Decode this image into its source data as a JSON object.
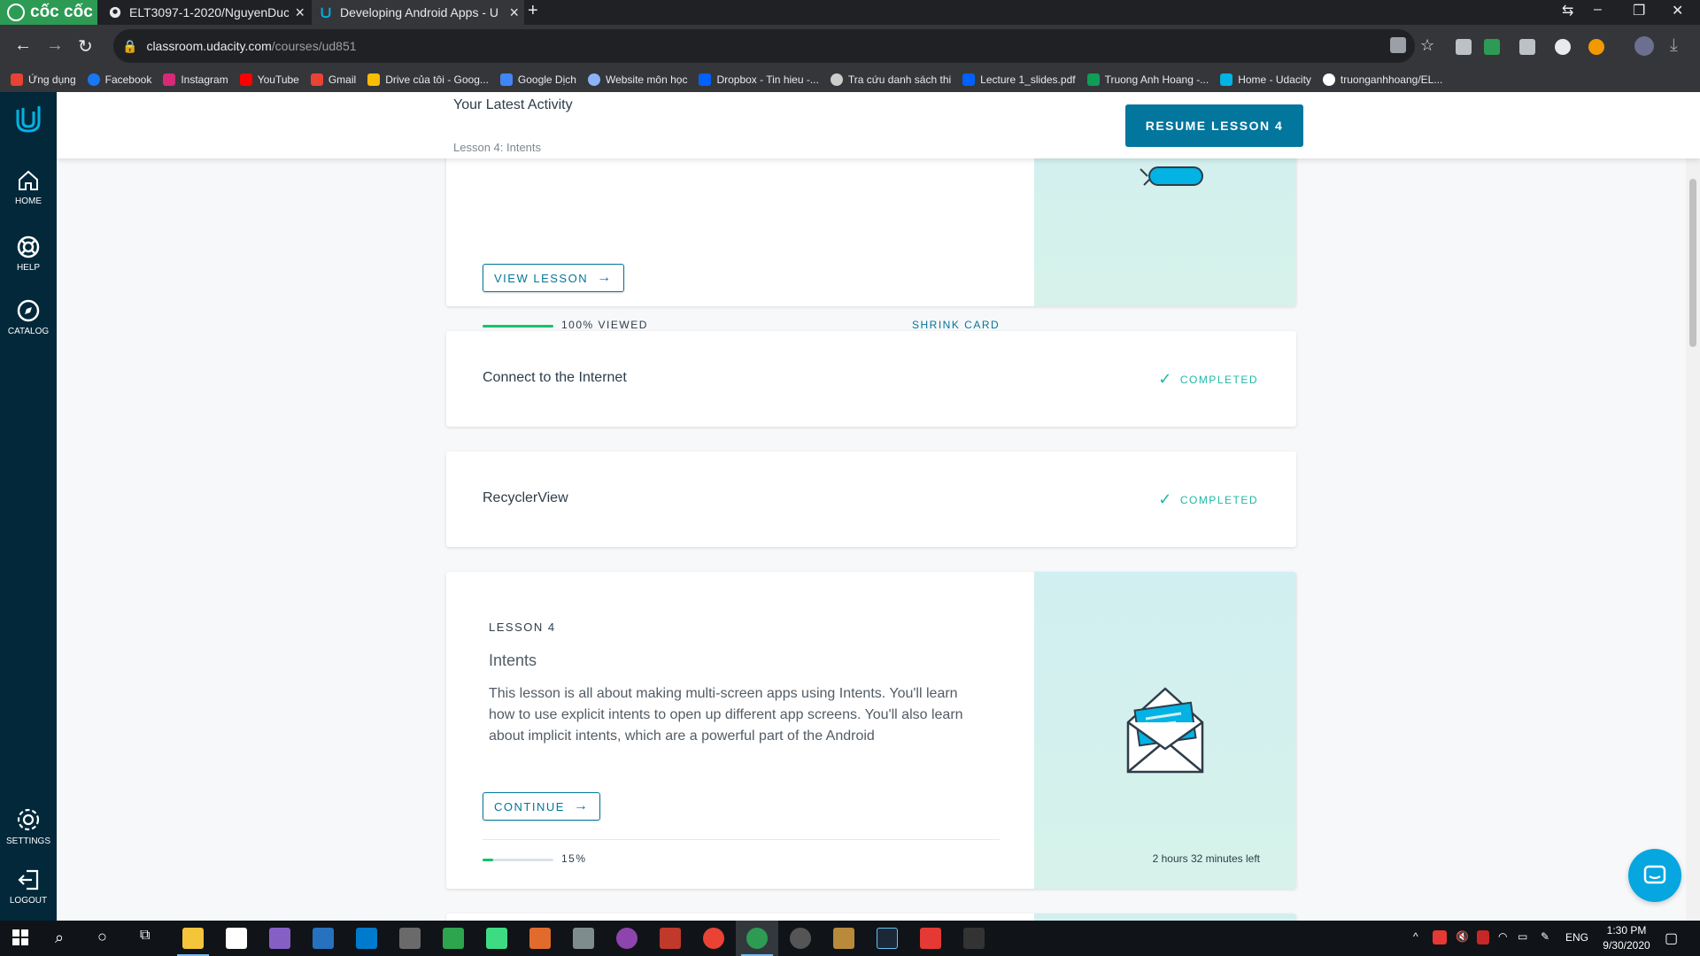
{
  "browser": {
    "brand_label": "cốc cốc",
    "tabs": [
      {
        "title": "ELT3097-1-2020/NguyenDuc",
        "icon": "github-icon"
      },
      {
        "title": "Developing Android Apps - U",
        "icon": "udacity-icon"
      }
    ],
    "url_host": "classroom.udacity.com",
    "url_path": "/courses/ud851",
    "bookmarks": [
      {
        "label": "Ứng dụng",
        "color": "#e94235"
      },
      {
        "label": "Facebook",
        "color": "#1877f2"
      },
      {
        "label": "Instagram",
        "color": "#d62976"
      },
      {
        "label": "YouTube",
        "color": "#ff0000"
      },
      {
        "label": "Gmail",
        "color": "#ea4335"
      },
      {
        "label": "Drive của tôi - Goog...",
        "color": "#fbbc04"
      },
      {
        "label": "Google Dịch",
        "color": "#4285f4"
      },
      {
        "label": "Website môn học",
        "color": "#8ab4f8"
      },
      {
        "label": "Dropbox - Tin hieu -...",
        "color": "#0061ff"
      },
      {
        "label": "Tra cứu danh sách thi",
        "color": "#cccccc"
      },
      {
        "label": "Lecture 1_slides.pdf",
        "color": "#0061ff"
      },
      {
        "label": "Truong Anh Hoang -...",
        "color": "#0f9d58"
      },
      {
        "label": "Home - Udacity",
        "color": "#02b3e4"
      },
      {
        "label": "truonganhhoang/EL...",
        "color": "#ffffff"
      }
    ]
  },
  "sidebar": {
    "items": [
      {
        "label": "HOME",
        "icon": "home-icon"
      },
      {
        "label": "HELP",
        "icon": "lifebuoy-icon"
      },
      {
        "label": "CATALOG",
        "icon": "compass-icon"
      },
      {
        "label": "SETTINGS",
        "icon": "gear-icon"
      },
      {
        "label": "LOGOUT",
        "icon": "logout-icon"
      }
    ]
  },
  "activity": {
    "title": "Your Latest Activity",
    "subtitle": "Lesson 4: Intents",
    "resume_label": "RESUME LESSON 4"
  },
  "cards": {
    "expanded_top": {
      "view_label": "VIEW LESSON",
      "progress_label": "100% VIEWED",
      "progress": 1.0,
      "shrink_label": "SHRINK CARD"
    },
    "connect": {
      "title": "Connect to the Internet",
      "status": "COMPLETED"
    },
    "recycler": {
      "title": "RecyclerView",
      "status": "COMPLETED"
    },
    "lesson4": {
      "label": "LESSON 4",
      "title": "Intents",
      "description": "This lesson is all about making multi-screen apps using Intents. You'll learn how to use explicit intents to open up different app screens. You'll also learn about implicit intents, which are a powerful part of the Android",
      "continue_label": "CONTINUE",
      "progress_label": "15%",
      "progress": 0.15,
      "time_left": "2 hours 32 minutes left"
    }
  },
  "colors": {
    "udacity_blue": "#02769c",
    "progress_green": "#15c26b",
    "completed_teal": "#1fb8a8",
    "sidebar_bg": "#02283a"
  },
  "taskbar": {
    "time": "1:30 PM",
    "date": "9/30/2020",
    "language": "ENG"
  }
}
